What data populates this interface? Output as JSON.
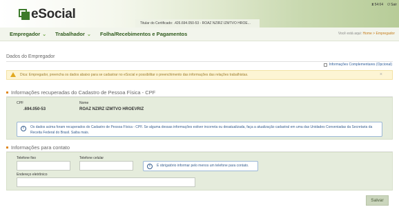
{
  "header": {
    "logo_text": "eSocial",
    "certificate_text": "Titular do Certificado: .426.694.050-53 - ROAZ NZIRZ IZMTVO HROE...",
    "timer": "54:04",
    "exit_label": "Sair"
  },
  "menu": {
    "items": [
      {
        "label": "Empregador"
      },
      {
        "label": "Trabalhador"
      },
      {
        "label": "Folha/Recebimentos e Pagamentos"
      }
    ]
  },
  "breadcrumb": {
    "prefix": "Você está aqui:",
    "home": "Home",
    "separator": ">",
    "current": "Empregador"
  },
  "page": {
    "title": "Dados do Empregador",
    "complementary_checkbox_label": "Informações Complementares (Opcional)"
  },
  "alert": {
    "text": "Dica: Empregador, preencha os dados abaixo para se cadastrar no eSocial e possibilitar o preenchimento das informações das relações trabalhistas.",
    "close": "×"
  },
  "cpf_section": {
    "title": "Informações recuperadas do Cadastro de Pessoa Física - CPF",
    "cpf_label": "CPF",
    "cpf_value": ".694.050-53",
    "name_label": "Nome",
    "name_value": "ROAZ NZIRZ IZMTVO HROEVRIZ",
    "info_text": "Os dados acima foram recuperados do Cadastro de Pessoa Física - CPF. Se alguma dessas informações estiver incorreta ou desatualizada, faça a atualização cadastral em uma das Unidades Conveniadas da Secretaria da Receita Federal do Brasil. Saiba mais."
  },
  "contact_section": {
    "title": "Informações para contato",
    "phone_label": "Telefone fixo",
    "phone_value": "",
    "mobile_label": "Telefone celular",
    "mobile_value": "",
    "required_info": "É obrigatório informar pelo menos um telefone para contato.",
    "email_label": "Endereço eletrônico",
    "email_value": ""
  },
  "actions": {
    "save_label": "Salvar"
  },
  "colors": {
    "brand_green": "#3c7a2a",
    "menu_text": "#2e5a1c",
    "accent_orange": "#e0871c",
    "info_blue": "#355d8e"
  }
}
